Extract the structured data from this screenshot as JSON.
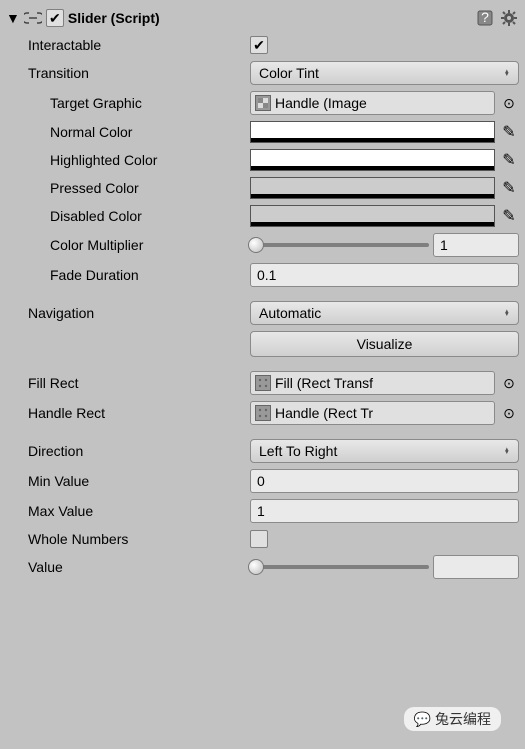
{
  "header": {
    "title": "Slider (Script)",
    "enabled": true
  },
  "properties": {
    "interactable": {
      "label": "Interactable",
      "value": true
    },
    "transition": {
      "label": "Transition",
      "value": "Color Tint"
    },
    "targetGraphic": {
      "label": "Target Graphic",
      "value": "Handle (Image"
    },
    "normalColor": {
      "label": "Normal Color"
    },
    "highlightedColor": {
      "label": "Highlighted Color"
    },
    "pressedColor": {
      "label": "Pressed Color"
    },
    "disabledColor": {
      "label": "Disabled Color"
    },
    "colorMultiplier": {
      "label": "Color Multiplier",
      "value": "1"
    },
    "fadeDuration": {
      "label": "Fade Duration",
      "value": "0.1"
    },
    "navigation": {
      "label": "Navigation",
      "value": "Automatic"
    },
    "visualize": {
      "label": "Visualize"
    },
    "fillRect": {
      "label": "Fill Rect",
      "value": "Fill (Rect Transf"
    },
    "handleRect": {
      "label": "Handle Rect",
      "value": "Handle (Rect Tr"
    },
    "direction": {
      "label": "Direction",
      "value": "Left To Right"
    },
    "minValue": {
      "label": "Min Value",
      "value": "0"
    },
    "maxValue": {
      "label": "Max Value",
      "value": "1"
    },
    "wholeNumbers": {
      "label": "Whole Numbers",
      "value": false
    },
    "value": {
      "label": "Value",
      "value": ""
    }
  },
  "watermark": "兔云编程"
}
